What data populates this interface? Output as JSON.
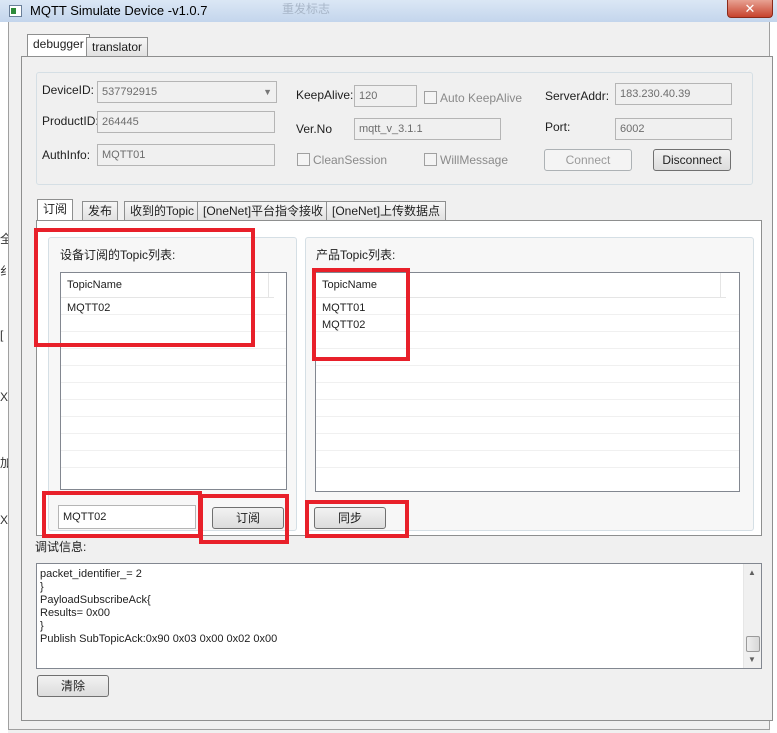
{
  "window": {
    "title": "MQTT Simulate Device  -v1.0.7",
    "ghost_title": "重发标志",
    "close_glyph": "✕"
  },
  "left_strip_glyphs": [
    "全",
    "纟",
    "[",
    "X",
    "加",
    "X"
  ],
  "main_tabs": [
    {
      "label": "debugger",
      "active": true
    },
    {
      "label": "translator",
      "active": false
    }
  ],
  "connection": {
    "device_id": {
      "label": "DeviceID:",
      "value": "537792915"
    },
    "product_id": {
      "label": "ProductID:",
      "value": "264445"
    },
    "auth_info": {
      "label": "AuthInfo:",
      "value": "MQTT01"
    },
    "keep_alive": {
      "label": "KeepAlive:",
      "value": "120"
    },
    "auto_keep_alive": {
      "label": "Auto KeepAlive",
      "checked": false
    },
    "ver_no": {
      "label": "Ver.No",
      "value": "mqtt_v_3.1.1"
    },
    "clean_session": {
      "label": "CleanSession",
      "checked": false
    },
    "will_message": {
      "label": "WillMessage",
      "checked": false
    },
    "server_addr": {
      "label": "ServerAddr:",
      "value": "183.230.40.39"
    },
    "port": {
      "label": "Port:",
      "value": "6002"
    },
    "connect_label": "Connect",
    "disconnect_label": "Disconnect"
  },
  "sub_tabs": [
    {
      "label": "订阅",
      "active": true
    },
    {
      "label": "发布",
      "active": false
    },
    {
      "label": "收到的Topic",
      "active": false
    },
    {
      "label": "[OneNet]平台指令接收",
      "active": false
    },
    {
      "label": "[OneNet]上传数据点",
      "active": false
    }
  ],
  "subscribe": {
    "device_topics_title": "设备订阅的Topic列表:",
    "device_topics_header": "TopicName",
    "device_topics": [
      "MQTT02"
    ],
    "topic_input_value": "MQTT02",
    "subscribe_button": "订阅",
    "product_topics_title": "产品Topic列表:",
    "product_topics_header": "TopicName",
    "product_topics": [
      "MQTT01",
      "MQTT02"
    ],
    "sync_button": "同步"
  },
  "debug": {
    "label": "调试信息:",
    "lines": [
      "packet_identifier_= 2",
      "}",
      "PayloadSubscribeAck{",
      "Results= 0x00",
      "}",
      " Publish SubTopicAck:0x90 0x03 0x00 0x02 0x00"
    ],
    "clear_button": "清除"
  },
  "annotation_color": "#e8202a"
}
